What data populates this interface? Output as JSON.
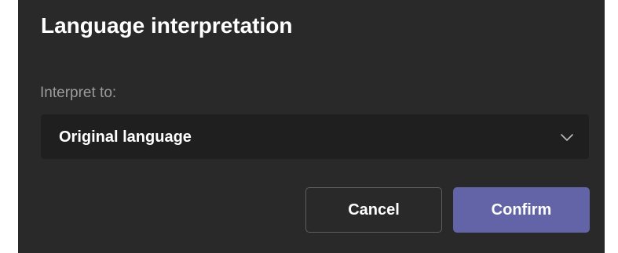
{
  "dialog": {
    "title": "Language interpretation",
    "field_label": "Interpret to:",
    "select": {
      "selected": "Original language",
      "icon": "chevron-down-icon"
    },
    "buttons": {
      "cancel": "Cancel",
      "confirm": "Confirm"
    }
  },
  "colors": {
    "background": "#292929",
    "field_background": "#1f1f1f",
    "label_text": "#9b9b9b",
    "accent": "#6264a7"
  }
}
